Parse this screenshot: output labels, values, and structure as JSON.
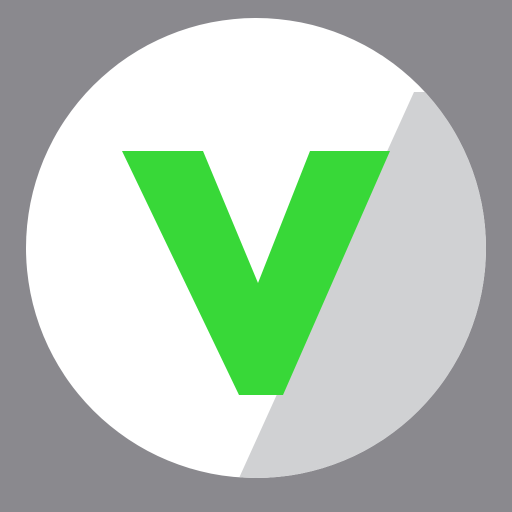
{
  "icon": {
    "name": "v-logo-icon",
    "letter": "V",
    "colors": {
      "background": "#8a898e",
      "circle": "#ffffff",
      "shadow": "#d0d1d3",
      "letter": "#38d838"
    }
  }
}
